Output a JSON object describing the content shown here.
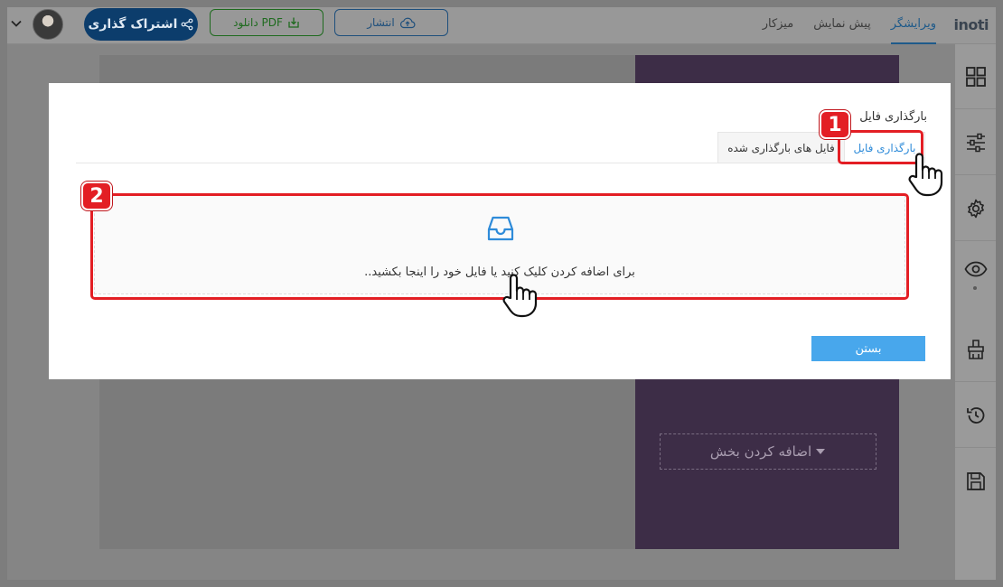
{
  "topbar": {
    "logo": "inoti",
    "nav": [
      {
        "label": "ویرایشگر",
        "active": true
      },
      {
        "label": "پیش نمایش",
        "active": false
      },
      {
        "label": "میزکار",
        "active": false
      }
    ],
    "publish_label": "انتشار",
    "pdf_label": "دانلود PDF",
    "share_label": "اشتراک گذاری"
  },
  "canvas": {
    "add_section_label": "اضافه کردن بخش"
  },
  "modal": {
    "title": "بارگذاری فایل",
    "tab_upload": "بارگذاری فایل",
    "tab_uploaded": "فایل های بارگذاری شده",
    "dropzone_text": "برای اضافه کردن کلیک کنید یا فایل خود را اینجا بکشید..",
    "close_label": "بستن"
  },
  "annotations": {
    "badge_1": "1",
    "badge_2": "2"
  },
  "colors": {
    "accent": "#2e8bd9",
    "highlight": "#e31e24",
    "close_button": "#48a7ec"
  }
}
